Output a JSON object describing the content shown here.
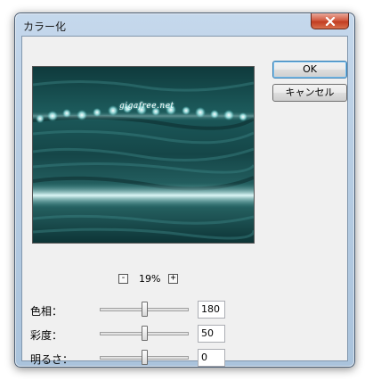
{
  "dialog": {
    "title": "カラー化",
    "ok_label": "OK",
    "cancel_label": "キャンセル"
  },
  "preview": {
    "watermark": "gigafree.net",
    "zoom_out_symbol": "-",
    "zoom_in_symbol": "+",
    "zoom_level": "19%"
  },
  "controls": [
    {
      "label": "色相：",
      "value": "180",
      "slider_fraction": 0.5
    },
    {
      "label": "彩度：",
      "value": "50",
      "slider_fraction": 0.5
    },
    {
      "label": "明るさ：",
      "value": "0",
      "slider_fraction": 0.5
    }
  ],
  "colors": {
    "preview_tint": "#1d5c5c",
    "close_button": "#c23d22",
    "default_button_border": "#3c7fb1"
  },
  "icons": {
    "close": "close-icon",
    "zoom_out": "minus-icon",
    "zoom_in": "plus-icon"
  }
}
